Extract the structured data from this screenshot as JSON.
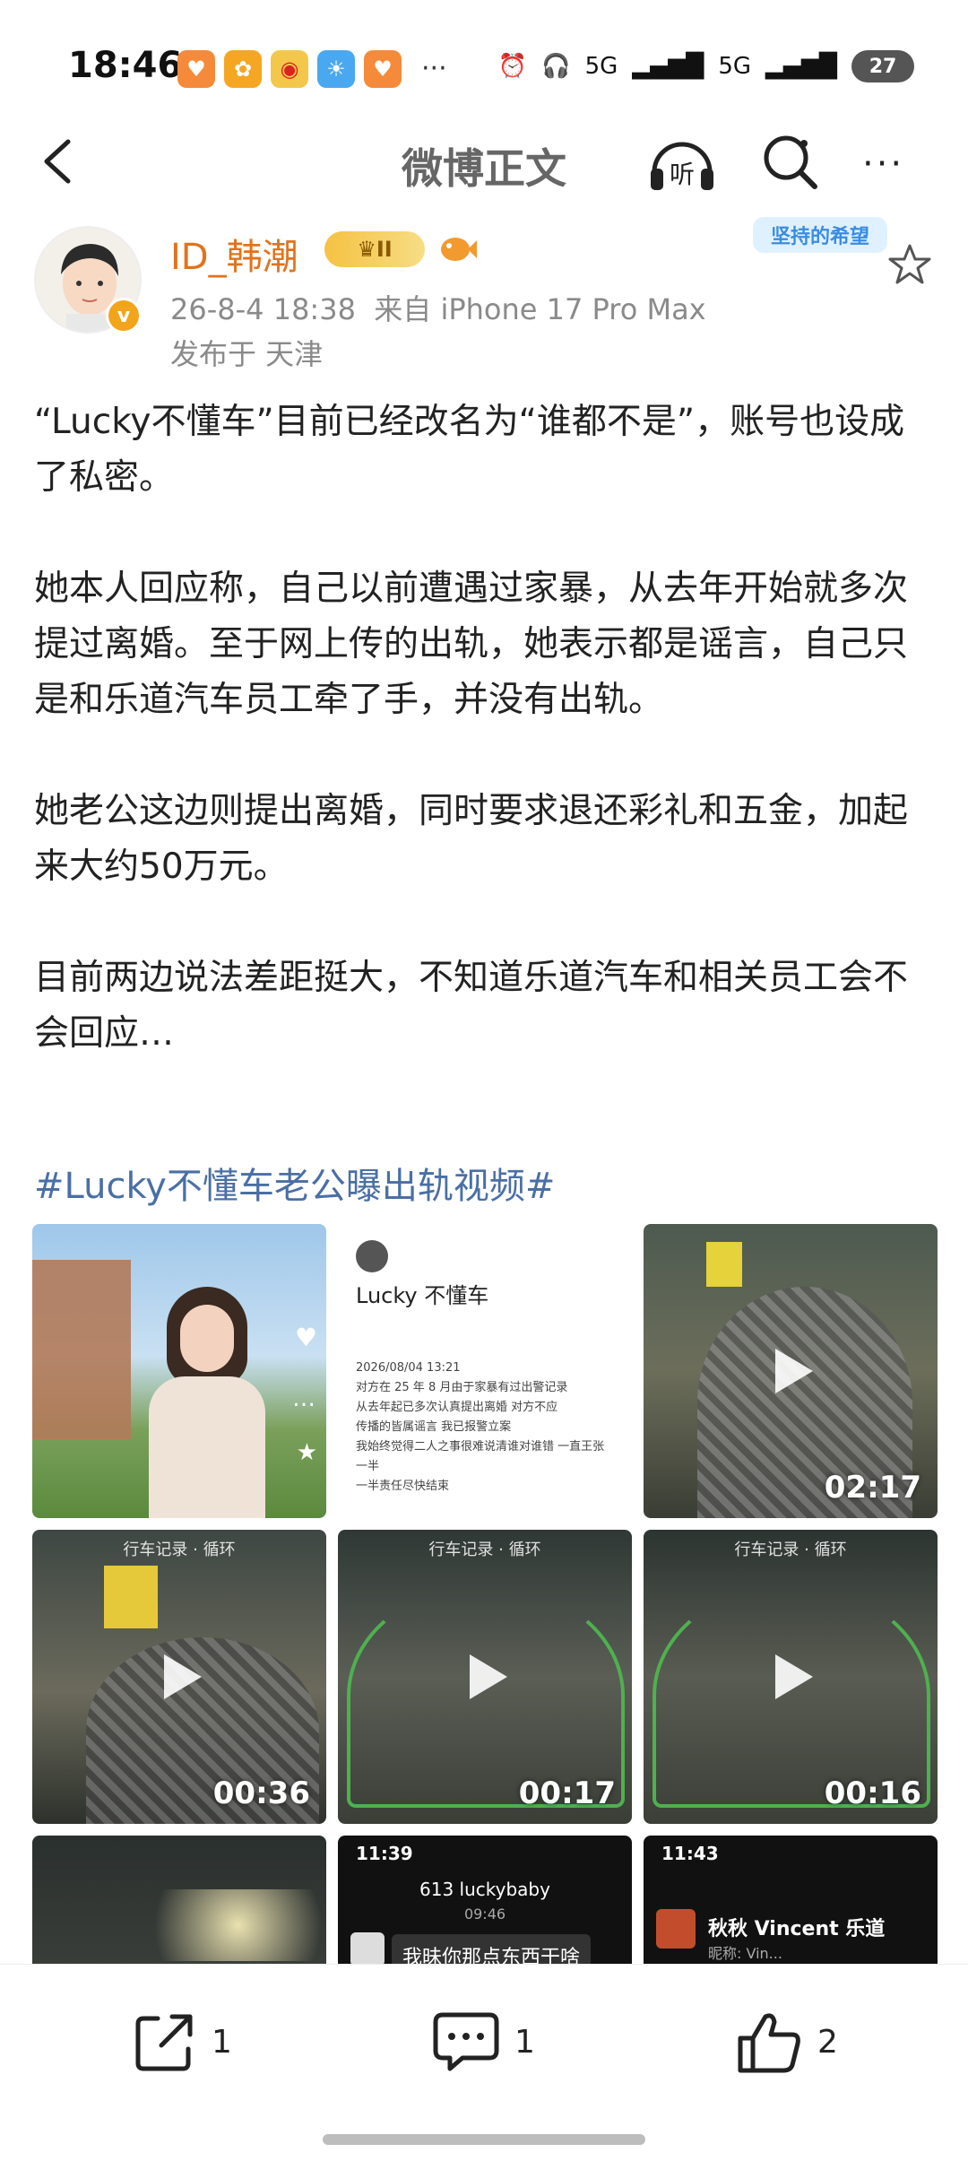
{
  "status_bar": {
    "time": "18:46",
    "network_1": "5G",
    "network_2": "5G",
    "battery": "27",
    "more": "···"
  },
  "nav": {
    "title": "微博正文",
    "listen_label": "听",
    "more": "···"
  },
  "post": {
    "username": "ID_韩潮",
    "level_badge": "II",
    "sticker": "坚持的希望",
    "timestamp": "26-8-4 18:38",
    "source": "来自 iPhone 17 Pro Max",
    "location": "发布于 天津",
    "paragraphs": [
      "“Lucky不懂车”目前已经改名为“谁都不是”，账号也设成了私密。",
      "她本人回应称，自己以前遭遇过家暴，从去年开始就多次提过离婚。至于网上传的出轨，她表示都是谣言，自己只是和乐道汽车员工牵了手，并没有出轨。",
      "她老公这边则提出离婚，同时要求退还彩礼和五金，加起来大约50万元。",
      "目前两边说法差距挺大，不知道乐道汽车和相关员工会不会回应…"
    ],
    "hashtag": "#Lucky不懂车老公曝出轨视频#"
  },
  "media": {
    "tile2": {
      "name": "Lucky 不懂车",
      "lines": [
        "2026/08/04 13:21",
        "对方在 25 年 8 月由于家暴有过出警记录",
        "从去年起已多次认真提出离婚 对方不应",
        "传播的皆属谣言 我已报警立案",
        "我始终觉得二人之事很难说清谁对谁错 一直王张一半",
        "一半责任尽快结束"
      ]
    },
    "durations": [
      "02:17",
      "00:36",
      "00:17",
      "00:16"
    ],
    "cam_label": "行车记录 · 循环",
    "tile8": {
      "time": "11:39",
      "name": "613 luckybaby",
      "sub": "09:46",
      "bubble": "我昧你那点东西干啥"
    },
    "tile9": {
      "time": "11:43",
      "name": "秋秋 Vincent 乐道",
      "sub": "昵称: Vin..."
    }
  },
  "bottom": {
    "share_count": "1",
    "comment_count": "1",
    "like_count": "2"
  }
}
